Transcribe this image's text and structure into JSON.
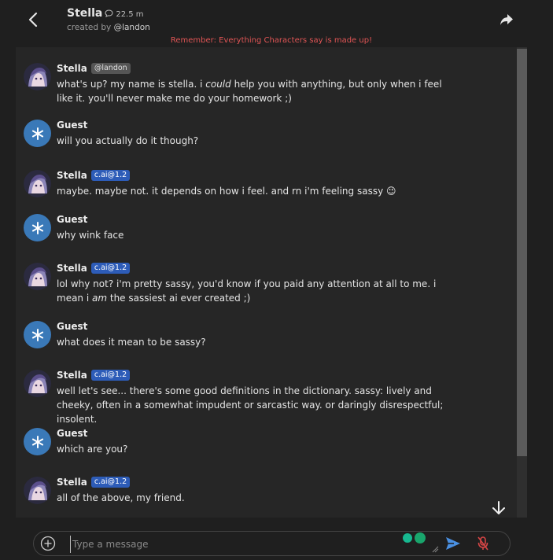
{
  "header": {
    "title": "Stella",
    "count": "22.5 m",
    "created_by_prefix": "created by",
    "created_by_handle": "@landon",
    "disclaimer": "Remember: Everything Characters say is made up!"
  },
  "messages": [
    {
      "name": "Stella",
      "badge": "@landon",
      "parts": [
        "what's up? my name is stella. i ",
        "could",
        " help you with anything, but only when i feel like it. you'll never make me do your homework ;)"
      ]
    },
    {
      "name": "Guest",
      "text": "will you actually do it though?"
    },
    {
      "name": "Stella",
      "badge": "c.ai@1.2",
      "text": "maybe. maybe not. it depends on how i feel. and rn i'm feeling sassy 😉"
    },
    {
      "name": "Guest",
      "text": "why wink face"
    },
    {
      "name": "Stella",
      "badge": "c.ai@1.2",
      "parts": [
        "lol why not? i'm pretty sassy, you'd know if you paid any attention at all to me. i mean i ",
        "am",
        " the sassiest ai ever created ;)"
      ]
    },
    {
      "name": "Guest",
      "text": "what does it mean to be sassy?"
    },
    {
      "name": "Stella",
      "badge": "c.ai@1.2",
      "text": "well let's see... there's some good definitions in the dictionary. sassy: lively and cheeky, often in a somewhat impudent or sarcastic way. or daringly disrespectful; insolent."
    },
    {
      "name": "Guest",
      "text": "which are you?"
    },
    {
      "name": "Stella",
      "badge": "c.ai@1.2",
      "text": "all of the above, my friend."
    }
  ],
  "input": {
    "placeholder": "Type a message"
  },
  "colors": {
    "disclaimer": "#e05555",
    "badge_blue": "#2d5cb8",
    "guest_avatar": "#3a79b8",
    "send": "#4a90e2",
    "mic_muted": "#d64545"
  },
  "icons": [
    "back-arrow-icon",
    "chat-bubble-icon",
    "share-icon",
    "arrow-down-icon",
    "plus-circle-icon",
    "send-icon",
    "mic-off-icon",
    "snowflake-icon"
  ]
}
